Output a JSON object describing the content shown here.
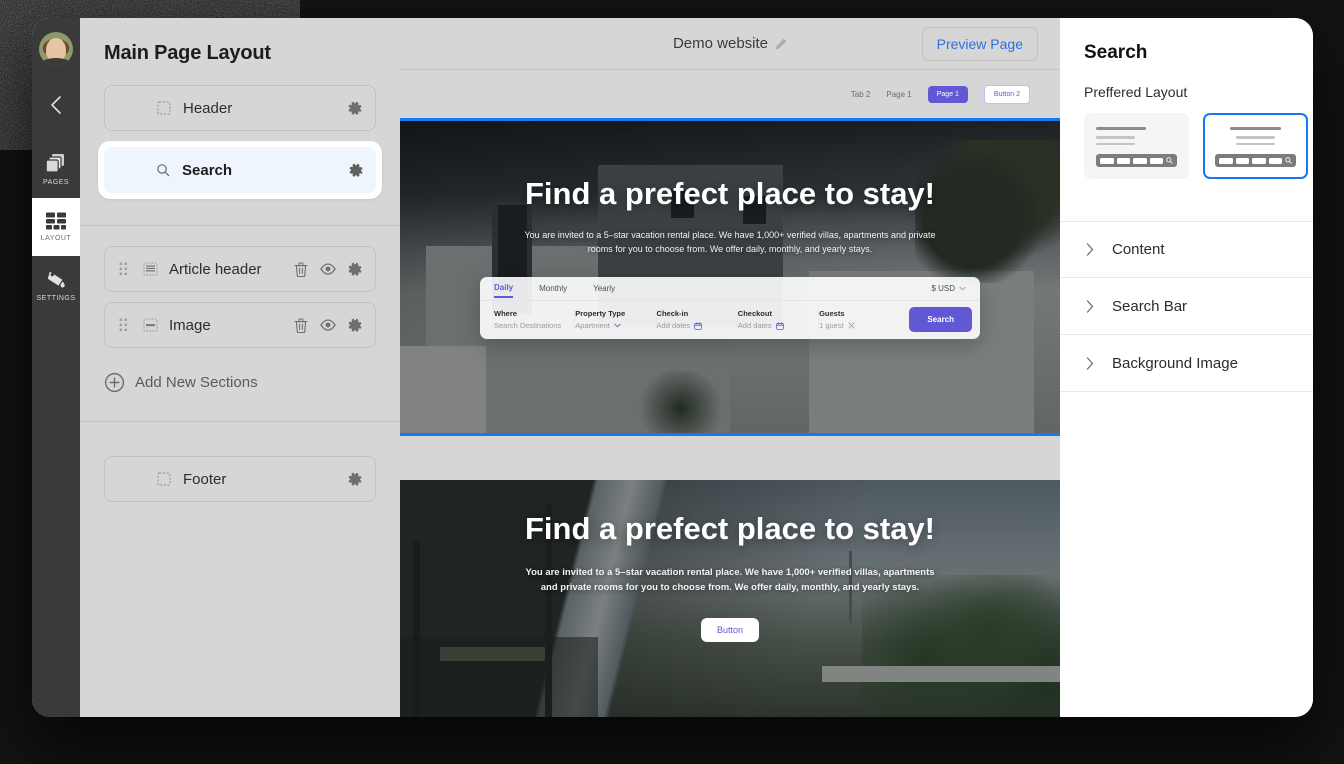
{
  "rail": {
    "avatar_name": "user-avatar",
    "back_label": "back",
    "items": [
      {
        "icon": "pages-icon",
        "label": "PAGES",
        "active": false
      },
      {
        "icon": "layout-icon",
        "label": "LAYOUT",
        "active": true
      },
      {
        "icon": "settings-icon",
        "label": "SETTINGS",
        "active": false
      }
    ]
  },
  "layout_panel": {
    "title": "Main Page Layout",
    "header_section": {
      "label": "Header",
      "icon": "dashed-box-icon",
      "gear": "gear-icon"
    },
    "search_section": {
      "label": "Search",
      "icon": "search-icon",
      "gear": "gear-icon",
      "selected": true
    },
    "body_sections": [
      {
        "label": "Article header",
        "icon": "dashed-lines-icon",
        "grip": "drag-handle-icon",
        "trash": "trash-icon",
        "eye": "eye-icon",
        "gear": "gear-icon"
      },
      {
        "label": "Image",
        "icon": "dashed-image-icon",
        "grip": "drag-handle-icon",
        "trash": "trash-icon",
        "eye": "eye-icon",
        "gear": "gear-icon"
      }
    ],
    "add_new": {
      "label": "Add New Sections",
      "icon": "plus-circle-icon"
    },
    "footer_section": {
      "label": "Footer",
      "icon": "dashed-box-icon",
      "gear": "gear-icon"
    }
  },
  "canvas": {
    "site_title": "Demo website",
    "edit_icon": "pencil-icon",
    "preview_button": "Preview Page",
    "nav": {
      "links": [
        "Tab 2",
        "Page 1"
      ],
      "primary_button": "Page 1",
      "ghost_button": "Button 2"
    },
    "hero1": {
      "heading": "Find a prefect place to stay!",
      "paragraph": "You are invited to a 5–star vacation rental place. We have 1,000+ verified villas, apartments and private rooms for you to choose from. We offer daily, monthly, and yearly stays.",
      "selected": true
    },
    "hero2": {
      "heading": "Find a prefect place to stay!",
      "paragraph": "You are invited to a 5–star vacation rental place. We have 1,000+ verified villas, apartments and private rooms for you to choose from. We offer daily, monthly, and yearly stays.",
      "button": "Button"
    },
    "search_widget": {
      "tabs": [
        "Daily",
        "Monthly",
        "Yearly"
      ],
      "active_tab": "Daily",
      "currency": "$ USD",
      "currency_caret": "chevron-down-icon",
      "fields": [
        {
          "label": "Where",
          "value": "Search Destinations",
          "affix": ""
        },
        {
          "label": "Property Type",
          "value": "Apartment",
          "affix": "chevron-down-icon"
        },
        {
          "label": "Check-in",
          "value": "Add dates",
          "affix": "calendar-icon"
        },
        {
          "label": "Checkout",
          "value": "Add dates",
          "affix": "calendar-icon"
        },
        {
          "label": "Guests",
          "value": "1 guest",
          "affix": "close-icon"
        }
      ],
      "search_button": "Search"
    }
  },
  "props_panel": {
    "title": "Search",
    "preferred_layout_label": "Preffered Layout",
    "layout_options": [
      {
        "name": "layout-left-aligned",
        "selected": false
      },
      {
        "name": "layout-center-aligned",
        "selected": true
      }
    ],
    "accordions": [
      {
        "label": "Content",
        "chevron": "chevron-right-icon"
      },
      {
        "label": "Search Bar",
        "chevron": "chevron-right-icon"
      },
      {
        "label": "Background Image",
        "chevron": "chevron-right-icon"
      }
    ]
  },
  "colors": {
    "accent_blue": "#1877f2",
    "link_blue": "#2f6fdd",
    "brand_purple": "#6258d6",
    "rail_dark": "#3a3a3a",
    "panel_gray": "#d6d6d6",
    "selected_row": "#eff5fc"
  }
}
